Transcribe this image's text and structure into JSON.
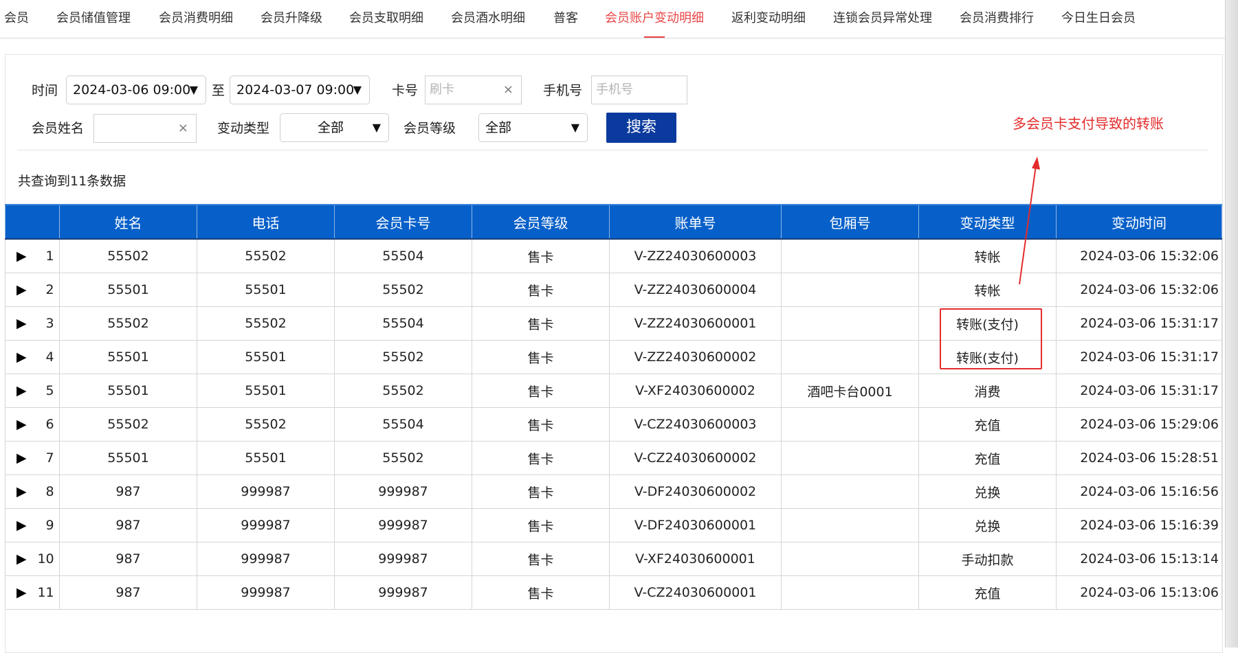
{
  "tabs": [
    {
      "label": "会员",
      "active": false
    },
    {
      "label": "会员储值管理",
      "active": false
    },
    {
      "label": "会员消费明细",
      "active": false
    },
    {
      "label": "会员升降级",
      "active": false
    },
    {
      "label": "会员支取明细",
      "active": false
    },
    {
      "label": "会员酒水明细",
      "active": false
    },
    {
      "label": "普客",
      "active": false
    },
    {
      "label": "会员账户变动明细",
      "active": true
    },
    {
      "label": "返利变动明细",
      "active": false
    },
    {
      "label": "连锁会员异常处理",
      "active": false
    },
    {
      "label": "会员消费排行",
      "active": false
    },
    {
      "label": "今日生日会员",
      "active": false
    }
  ],
  "filters": {
    "time_label": "时间",
    "start_time": "2024-03-06 09:00",
    "to_label": "至",
    "end_time": "2024-03-07 09:00",
    "card_label": "卡号",
    "card_placeholder": "刷卡",
    "phone_label": "手机号",
    "phone_placeholder": "手机号",
    "name_label": "会员姓名",
    "name_value": "",
    "change_type_label": "变动类型",
    "change_type_value": "全部",
    "level_label": "会员等级",
    "level_value": "全部",
    "search_label": "搜索",
    "clear_glyph": "×",
    "caret_glyph": "▼"
  },
  "summary": "共查询到11条数据",
  "annotation": "多会员卡支付导致的转账",
  "table": {
    "headers": [
      "",
      "姓名",
      "电话",
      "会员卡号",
      "会员等级",
      "账单号",
      "包厢号",
      "变动类型",
      "变动时间"
    ],
    "rows": [
      {
        "no": "1",
        "name": "55502",
        "phone": "55502",
        "card": "55504",
        "level": "售卡",
        "bill": "V-ZZ24030600003",
        "room": "",
        "type": "转帐",
        "time": "2024-03-06 15:32:06"
      },
      {
        "no": "2",
        "name": "55501",
        "phone": "55501",
        "card": "55502",
        "level": "售卡",
        "bill": "V-ZZ24030600004",
        "room": "",
        "type": "转帐",
        "time": "2024-03-06 15:32:06"
      },
      {
        "no": "3",
        "name": "55502",
        "phone": "55502",
        "card": "55504",
        "level": "售卡",
        "bill": "V-ZZ24030600001",
        "room": "",
        "type": "转账(支付)",
        "time": "2024-03-06 15:31:17"
      },
      {
        "no": "4",
        "name": "55501",
        "phone": "55501",
        "card": "55502",
        "level": "售卡",
        "bill": "V-ZZ24030600002",
        "room": "",
        "type": "转账(支付)",
        "time": "2024-03-06 15:31:17"
      },
      {
        "no": "5",
        "name": "55501",
        "phone": "55501",
        "card": "55502",
        "level": "售卡",
        "bill": "V-XF24030600002",
        "room": "酒吧卡台0001",
        "type": "消费",
        "time": "2024-03-06 15:31:17"
      },
      {
        "no": "6",
        "name": "55502",
        "phone": "55502",
        "card": "55504",
        "level": "售卡",
        "bill": "V-CZ24030600003",
        "room": "",
        "type": "充值",
        "time": "2024-03-06 15:29:06"
      },
      {
        "no": "7",
        "name": "55501",
        "phone": "55501",
        "card": "55502",
        "level": "售卡",
        "bill": "V-CZ24030600002",
        "room": "",
        "type": "充值",
        "time": "2024-03-06 15:28:51"
      },
      {
        "no": "8",
        "name": "987",
        "phone": "999987",
        "card": "999987",
        "level": "售卡",
        "bill": "V-DF24030600002",
        "room": "",
        "type": "兑换",
        "time": "2024-03-06 15:16:56"
      },
      {
        "no": "9",
        "name": "987",
        "phone": "999987",
        "card": "999987",
        "level": "售卡",
        "bill": "V-DF24030600001",
        "room": "",
        "type": "兑换",
        "time": "2024-03-06 15:16:39"
      },
      {
        "no": "10",
        "name": "987",
        "phone": "999987",
        "card": "999987",
        "level": "售卡",
        "bill": "V-XF24030600001",
        "room": "",
        "type": "手动扣款",
        "time": "2024-03-06 15:13:14"
      },
      {
        "no": "11",
        "name": "987",
        "phone": "999987",
        "card": "999987",
        "level": "售卡",
        "bill": "V-CZ24030600001",
        "room": "",
        "type": "充值",
        "time": "2024-03-06 15:13:06"
      }
    ],
    "expand_icon": "expand-row-icon"
  },
  "colors": {
    "accent": "#e84545",
    "header_blue": "#0760c9",
    "button_blue": "#0b3a9e",
    "annotation_red": "#e42b2b"
  }
}
